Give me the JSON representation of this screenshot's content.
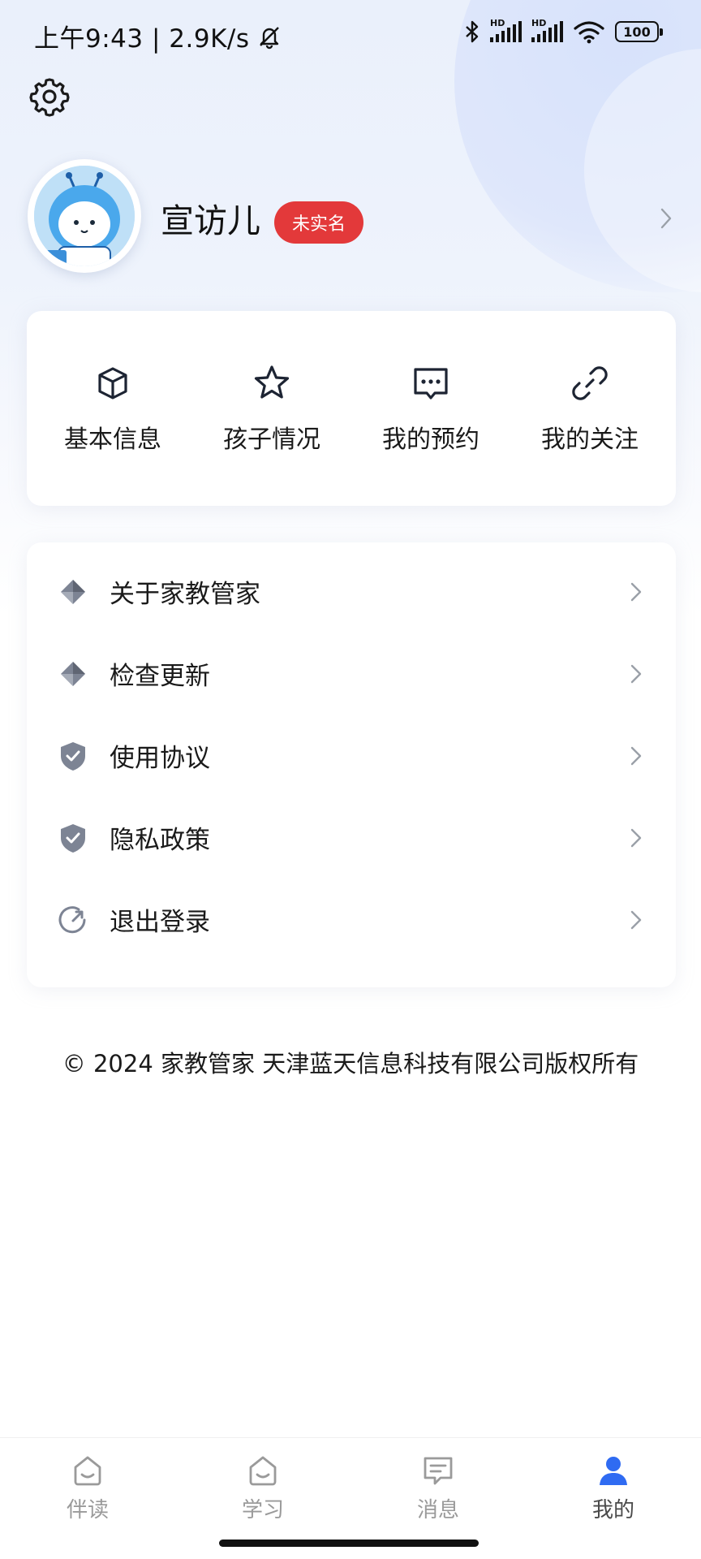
{
  "status_bar": {
    "time_speed": "上午9:43 | 2.9K/s",
    "battery": "100",
    "signal_tag": "HD"
  },
  "profile": {
    "name": "宣访儿",
    "badge": "未实名"
  },
  "quick_actions": [
    {
      "label": "基本信息",
      "icon": "cube-icon"
    },
    {
      "label": "孩子情况",
      "icon": "star-icon"
    },
    {
      "label": "我的预约",
      "icon": "chat-bubble-icon"
    },
    {
      "label": "我的关注",
      "icon": "link-icon"
    }
  ],
  "menu": [
    {
      "label": "关于家教管家",
      "icon": "diamond-icon"
    },
    {
      "label": "检查更新",
      "icon": "diamond-icon"
    },
    {
      "label": "使用协议",
      "icon": "shield-check-icon"
    },
    {
      "label": "隐私政策",
      "icon": "shield-check-icon"
    },
    {
      "label": "退出登录",
      "icon": "logout-icon"
    }
  ],
  "footer": "© 2024 家教管家 天津蓝天信息科技有限公司版权所有",
  "bottom_nav": [
    {
      "label": "伴读",
      "active": false
    },
    {
      "label": "学习",
      "active": false
    },
    {
      "label": "消息",
      "active": false
    },
    {
      "label": "我的",
      "active": true
    }
  ],
  "colors": {
    "badge": "#e3393a",
    "active_tab": "#2f6bf2",
    "icon_gray": "#7d8494"
  }
}
